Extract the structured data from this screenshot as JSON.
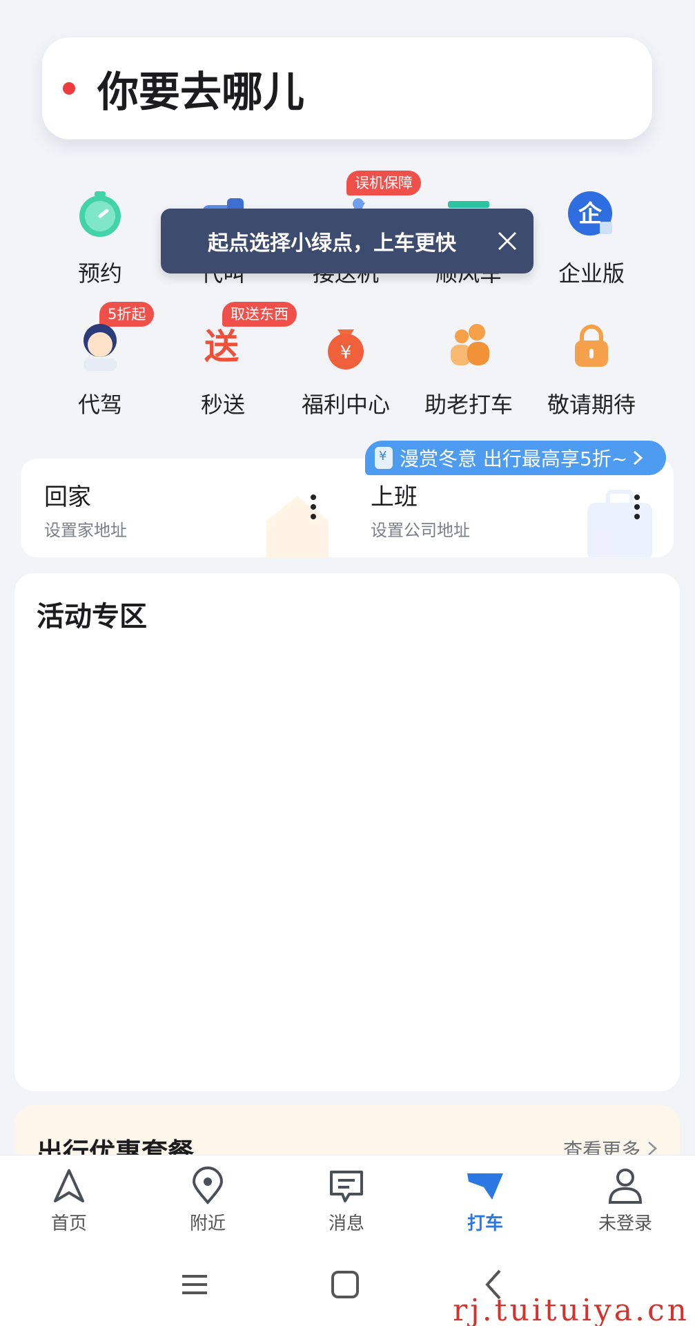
{
  "search": {
    "placeholder_text": "你要去哪儿"
  },
  "tooltip": {
    "text": "起点选择小绿点，上车更快"
  },
  "services": {
    "row1": [
      {
        "label": "预约",
        "badge": "",
        "icon": "clock-icon"
      },
      {
        "label": "代叫",
        "badge": "",
        "icon": "car-call-icon"
      },
      {
        "label": "接送机",
        "badge": "误机保障",
        "icon": "plane-icon"
      },
      {
        "label": "顺风车",
        "badge": "",
        "icon": "ride-share-icon"
      },
      {
        "label": "企业版",
        "badge": "",
        "icon": "enterprise-icon"
      }
    ],
    "row2": [
      {
        "label": "代驾",
        "badge": "5折起",
        "icon": "driver-avatar-icon"
      },
      {
        "label": "秒送",
        "badge": "取送东西",
        "icon": "delivery-icon"
      },
      {
        "label": "福利中心",
        "badge": "",
        "icon": "money-bag-icon"
      },
      {
        "label": "助老打车",
        "badge": "",
        "icon": "elder-care-icon"
      },
      {
        "label": "敬请期待",
        "badge": "",
        "icon": "lock-icon"
      }
    ]
  },
  "promo": {
    "text": "漫赏冬意 出行最高享5折~",
    "icon": "coin-icon"
  },
  "address": {
    "home": {
      "title": "回家",
      "subtitle": "设置家地址"
    },
    "work": {
      "title": "上班",
      "subtitle": "设置公司地址"
    }
  },
  "activity": {
    "title": "活动专区"
  },
  "package": {
    "title": "出行优惠套餐",
    "more": "查看更多"
  },
  "nav": [
    {
      "label": "首页",
      "icon": "navigation-arrow-icon",
      "active": false
    },
    {
      "label": "附近",
      "icon": "location-pin-icon",
      "active": false
    },
    {
      "label": "消息",
      "icon": "message-icon",
      "active": false
    },
    {
      "label": "打车",
      "icon": "taxi-flag-icon",
      "active": true
    },
    {
      "label": "未登录",
      "icon": "user-icon",
      "active": false
    }
  ],
  "colors": {
    "accent": "#2b78e4",
    "badge": "#f0504a",
    "tooltip_bg": "#3d4b6e",
    "promo_bg": "#4d9cf2"
  },
  "watermark": "rj.tuituiya.cn"
}
